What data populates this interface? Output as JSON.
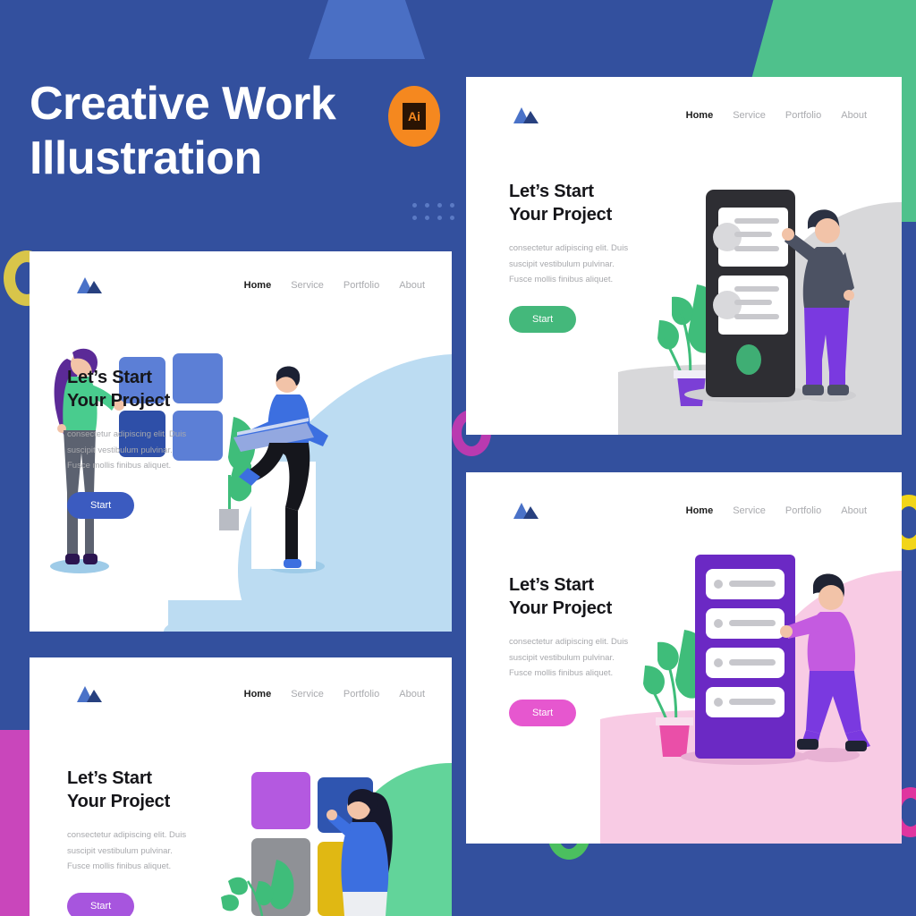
{
  "poster": {
    "title_line1": "Creative Work",
    "title_line2": "Illustration",
    "badge_label": "Ai",
    "background_color": "#33509e"
  },
  "nav_labels": {
    "home": "Home",
    "service": "Service",
    "portfolio": "Portfolio",
    "about": "About"
  },
  "cards": [
    {
      "id": "card-1",
      "logo": "mountain-logo",
      "heading_line1": "Let’s Start",
      "heading_line2": "Your Project",
      "body_line1": "consectetur adipiscing elit. Duis",
      "body_line2": "suscipit vestibulum pulvinar.",
      "body_line3": "Fusce mollis finibus aliquet.",
      "button_label": "Start",
      "button_color": "#3b5bc0",
      "illustration": "woman-tiles-man-laptop",
      "blob_color": "#bcdcf2"
    },
    {
      "id": "card-2",
      "logo": "mountain-logo",
      "heading_line1": "Let’s Start",
      "heading_line2": "Your Project",
      "body_line1": "consectetur adipiscing elit. Duis",
      "body_line2": "suscipit vestibulum pulvinar.",
      "body_line3": "Fusce mollis finibus aliquet.",
      "button_label": "Start",
      "button_color": "#44b87b",
      "illustration": "dark-server-man",
      "blob_color": "#d8d8da"
    },
    {
      "id": "card-3",
      "logo": "mountain-logo",
      "heading_line1": "Let’s Start",
      "heading_line2": "Your Project",
      "body_line1": "consectetur adipiscing elit. Duis",
      "body_line2": "suscipit vestibulum pulvinar.",
      "body_line3": "Fusce mollis finibus aliquet.",
      "button_label": "Start",
      "button_color": "#e657cf",
      "illustration": "purple-server-man-pushing",
      "blob_color": "#f8cbe4"
    },
    {
      "id": "card-4",
      "logo": "mountain-logo",
      "heading_line1": "Let’s Start",
      "heading_line2": "Your Project",
      "body_line1": "consectetur adipiscing elit. Duis",
      "body_line2": "suscipit vestibulum pulvinar.",
      "body_line3": "Fusce mollis finibus aliquet.",
      "button_label": "Start",
      "button_color": "#a755de",
      "illustration": "woman-color-tiles",
      "blob_color": "#62d49a"
    }
  ],
  "decor": {
    "ring_yellow_left": "#d8c54a",
    "ring_magenta_mid": "#b93ab0",
    "ring_yellow_right": "#f2d519",
    "ring_green_bottom": "#4bbf5f",
    "ring_magenta_bottom_right": "#e0359f",
    "corner_green": "#4fc18c",
    "corner_magenta": "#cc46b8"
  }
}
